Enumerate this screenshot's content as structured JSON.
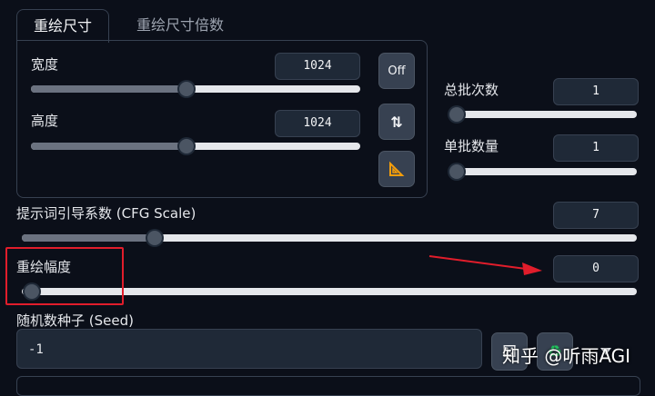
{
  "tabs": [
    {
      "label": "重绘尺寸",
      "active": true
    },
    {
      "label": "重绘尺寸倍数",
      "active": false
    }
  ],
  "width": {
    "label": "宽度",
    "value": "1024",
    "slider_fraction": 0.46
  },
  "height": {
    "label": "高度",
    "value": "1024",
    "slider_fraction": 0.46
  },
  "buttons": {
    "off_label": "Off",
    "swap_icon": "swap-vertical-icon",
    "ratio_icon": "set-square-icon"
  },
  "batch_count": {
    "label": "总批次数",
    "value": "1",
    "slider_fraction": 0.0
  },
  "batch_size": {
    "label": "单批数量",
    "value": "1",
    "slider_fraction": 0.0
  },
  "cfg_scale": {
    "label": "提示词引导系数 (CFG Scale)",
    "value": "7",
    "slider_fraction": 0.21
  },
  "denoising": {
    "label": "重绘幅度",
    "value": "0",
    "slider_fraction": 0.0
  },
  "seed": {
    "label": "随机数种子 (Seed)",
    "value": "-1",
    "dice_icon": "dice-icon",
    "recycle_icon": "recycle-icon"
  },
  "watermark": {
    "text": "知乎 @听雨AGI"
  },
  "colors": {
    "annotation_red": "#e11d2b",
    "background": "#0b0f19",
    "input_bg": "#1f2937"
  }
}
